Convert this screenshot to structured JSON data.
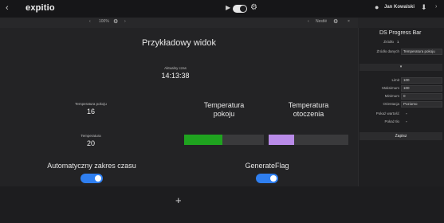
{
  "app": {
    "brand": "expitio",
    "back_icon": "‹",
    "user_name": "Jan Kowalski"
  },
  "canvas_strip": {
    "left_label": "100%",
    "right_label": "Nestlé"
  },
  "view": {
    "title": "Przykładowy widok",
    "time_label": "Aktualny czas",
    "time_value": "14:13:38",
    "temp_room_small_label": "Temperatura pokoju",
    "temp_room_value": "16",
    "temp_ambient_small_label": "Temperatura",
    "temp_ambient_value": "20",
    "bar1_label_line1": "Temperatura",
    "bar1_label_line2": "pokoju",
    "bar1_fraction": 0.48,
    "bar1_color": "#1fa31f",
    "bar2_label_line1": "Temperatura",
    "bar2_label_line2": "otoczenia",
    "bar2_fraction": 0.32,
    "bar2_color": "#b98be8",
    "switch1_label": "Automatyczny zakres czasu",
    "switch1_on": true,
    "switch2_label": "GenerateFlag",
    "switch2_on": true
  },
  "panel": {
    "title": "DS Progress Bar",
    "row_source_label": "Źródło",
    "row_source_value": "1",
    "row_data_label": "Źródło danych",
    "row_data_value": "Temperatura pokoju",
    "sep1": "▾",
    "limit_label": "Limit",
    "limit_value": "100",
    "max_label": "Maksimum",
    "max_value": "100",
    "min_label": "Minimum",
    "min_value": "0",
    "orient_label": "Orientacja",
    "orient_value": "Poziomo",
    "show_value_label": "Pokaż wartość",
    "show_bg_label": "Pokaż tło",
    "save_label": "Zapisz"
  },
  "add_icon": "+"
}
